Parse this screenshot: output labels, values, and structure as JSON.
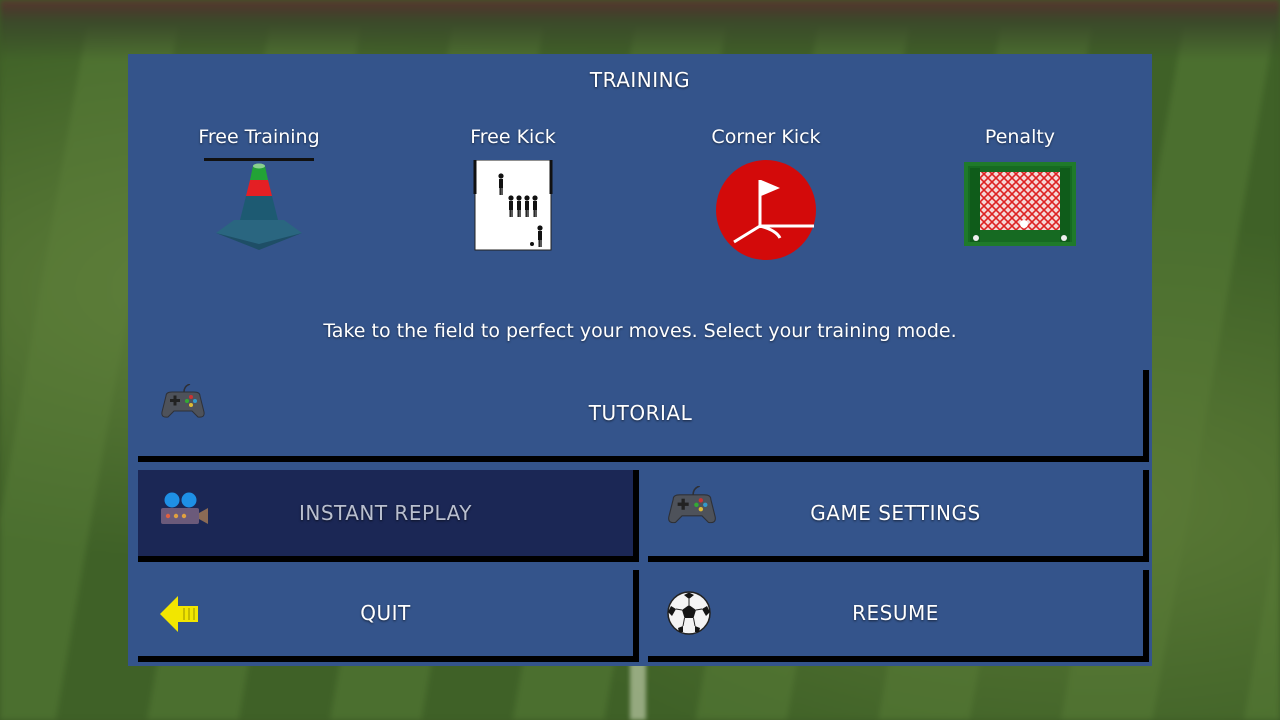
{
  "training": {
    "title": "TRAINING",
    "modes": [
      {
        "label": "Free Training",
        "icon": "traffic-cone-icon"
      },
      {
        "label": "Free Kick",
        "icon": "free-kick-wall-icon"
      },
      {
        "label": "Corner Kick",
        "icon": "corner-flag-icon"
      },
      {
        "label": "Penalty",
        "icon": "goal-net-icon"
      }
    ],
    "description": "Take to the field to perfect your moves. Select your training mode."
  },
  "menu": {
    "tutorial": {
      "label": "TUTORIAL",
      "icon": "gamepad-icon"
    },
    "instant_replay": {
      "label": "INSTANT REPLAY",
      "icon": "video-camera-icon"
    },
    "game_settings": {
      "label": "GAME SETTINGS",
      "icon": "gamepad-icon"
    },
    "quit": {
      "label": "QUIT",
      "icon": "back-arrow-icon"
    },
    "resume": {
      "label": "RESUME",
      "icon": "soccer-ball-icon"
    }
  },
  "colors": {
    "panel": "#34548b",
    "selected_button": "#1b2755",
    "button_shadow": "#000000"
  }
}
